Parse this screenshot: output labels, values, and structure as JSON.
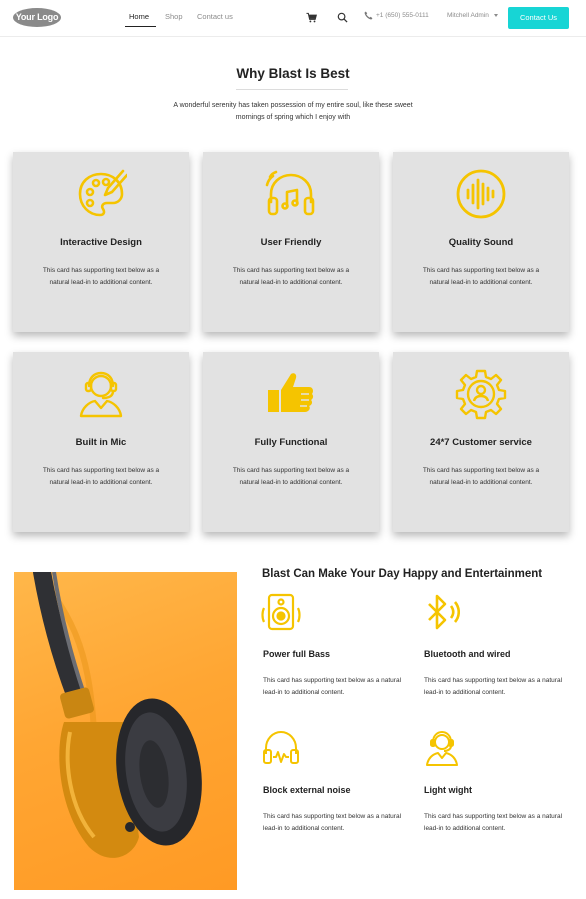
{
  "navbar": {
    "logo": "Your Logo",
    "links": [
      "Home",
      "Shop",
      "Contact us"
    ],
    "phone": "+1 (650) 555-0111",
    "user": "Mitchell Admin",
    "contact_button": "Contact Us",
    "icons": [
      "cart-icon",
      "search-icon",
      "phone-icon",
      "caret-down-icon"
    ]
  },
  "why": {
    "title": "Why Blast Is Best",
    "subtitle": "A wonderful serenity has taken possession of my entire soul, like these sweet mornings of spring which I enjoy with",
    "cards": [
      {
        "icon": "palette-icon",
        "title": "Interactive Design",
        "text": "This card has supporting text below as a natural lead-in to additional content."
      },
      {
        "icon": "headphones-music-icon",
        "title": "User Friendly",
        "text": "This card has supporting text below as a natural lead-in to additional content."
      },
      {
        "icon": "sound-wave-icon",
        "title": "Quality Sound",
        "text": "This card has supporting text below as a natural lead-in to additional content."
      },
      {
        "icon": "headset-person-icon",
        "title": "Built in Mic",
        "text": "This card has supporting text below as a natural lead-in to additional content."
      },
      {
        "icon": "thumbs-up-icon",
        "title": "Fully Functional",
        "text": "This card has supporting text below as a natural lead-in to additional content."
      },
      {
        "icon": "gear-person-icon",
        "title": "24*7 Customer service",
        "text": "This card has supporting text below as a natural lead-in to additional content."
      }
    ]
  },
  "features": {
    "title": "Blast Can Make Your Day Happy and Entertainment",
    "items": [
      {
        "icon": "speaker-icon",
        "title": "Power full Bass",
        "text": "This card has supporting text below as a natural lead-in to additional content."
      },
      {
        "icon": "bluetooth-icon",
        "title": "Bluetooth and wired",
        "text": "This card has supporting text below as a natural lead-in to additional content."
      },
      {
        "icon": "noise-headphones-icon",
        "title": "Block external noise",
        "text": "This card has supporting text below as a natural lead-in to additional content."
      },
      {
        "icon": "headset-person-icon",
        "title": "Light wight",
        "text": "This card has supporting text below as a natural lead-in to additional content."
      }
    ]
  },
  "colors": {
    "accent": "#17d5d5",
    "icon": "#f5c400",
    "card_bg": "#e2e2e2",
    "photo_bg": "#ffa633"
  }
}
